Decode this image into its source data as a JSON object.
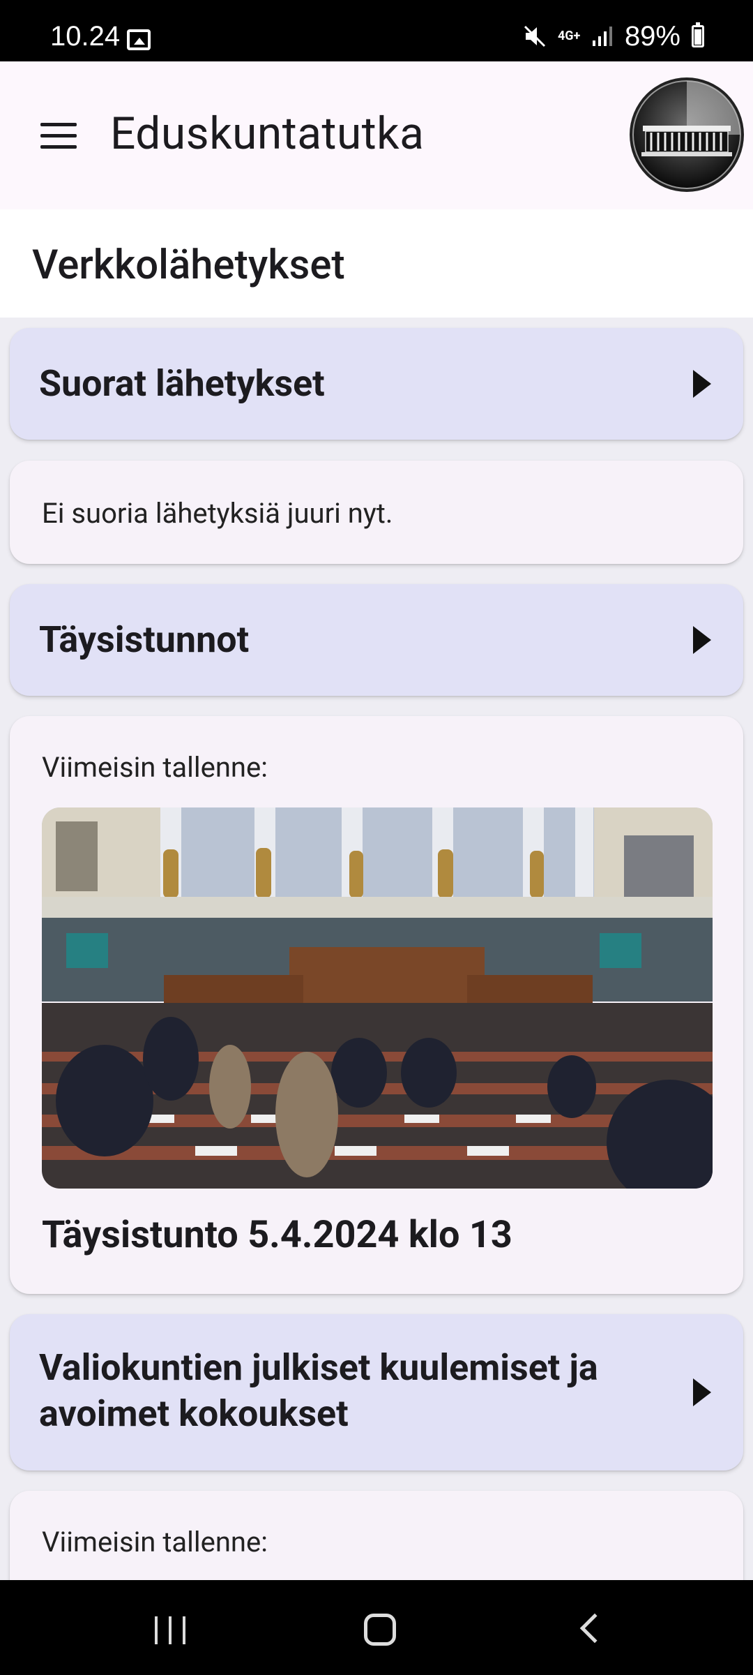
{
  "status_bar": {
    "time": "10.24",
    "battery": "89%",
    "network": "4G+"
  },
  "app_bar": {
    "title": "Eduskuntatutka"
  },
  "page": {
    "title": "Verkkolähetykset"
  },
  "sections": {
    "live": {
      "title": "Suorat lähetykset",
      "message": "Ei suoria lähetyksiä juuri nyt."
    },
    "plenary": {
      "title": "Täysistunnot",
      "latest_label": "Viimeisin tallenne:",
      "recording_title": "Täysistunto 5.4.2024 klo 13"
    },
    "committees": {
      "title_line1": "Valiokuntien julkiset kuulemiset ja",
      "title_line2": "avoimet kokoukset",
      "latest_label": "Viimeisin tallenne:"
    }
  },
  "icons": {
    "menu": "hamburger-menu-icon",
    "logo": "parliament-building-logo",
    "play": "play-arrow-icon"
  },
  "colors": {
    "section_card": "#e1e1f6",
    "content_card": "#f7f2f9",
    "app_bar": "#fdf7fd"
  }
}
